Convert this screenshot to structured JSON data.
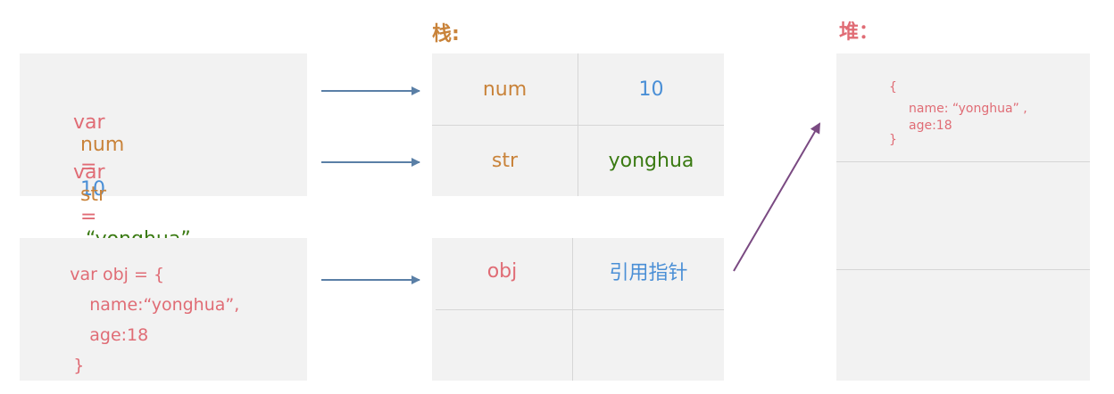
{
  "colors": {
    "keyword": "#e06c75",
    "primitive_name": "#c9833a",
    "number": "#4a8fd6",
    "string": "#3a7a12",
    "object_text": "#e06c75",
    "pointer": "#4a8fd6",
    "stack_title": "#c9833a",
    "heap_title": "#e06c75",
    "arrow_blue": "#5a7fa6",
    "arrow_purple": "#7a4a82",
    "panel_bg": "#f2f2f2",
    "grid_line": "#d6d6d6"
  },
  "code_primitives": {
    "line1": {
      "keyword": "var",
      "name": "num",
      "op": "=",
      "value": "10"
    },
    "line2": {
      "keyword": "var",
      "name": "str",
      "op": "=",
      "value": "“yonghua”"
    }
  },
  "code_object": {
    "line1": "var obj = {",
    "line2": "name:“yonghua”,",
    "line3": "age:18",
    "line4": "}"
  },
  "stack": {
    "title": "栈:",
    "rows": [
      {
        "name": "num",
        "value": "10"
      },
      {
        "name": "str",
        "value": "yonghua"
      }
    ],
    "object_row": {
      "name": "obj",
      "value": "引用指针"
    }
  },
  "heap": {
    "title": "堆：",
    "object": {
      "open": "{",
      "line1": "name: “yonghua” ,",
      "line2": "age:18",
      "close": "}"
    }
  },
  "arrows": [
    {
      "from": "code-line-num",
      "to": "stack-row-num",
      "color": "arrow_blue"
    },
    {
      "from": "code-line-str",
      "to": "stack-row-str",
      "color": "arrow_blue"
    },
    {
      "from": "code-obj",
      "to": "stack-row-obj",
      "color": "arrow_blue"
    },
    {
      "from": "stack-obj-pointer",
      "to": "heap-object",
      "color": "arrow_purple"
    }
  ]
}
